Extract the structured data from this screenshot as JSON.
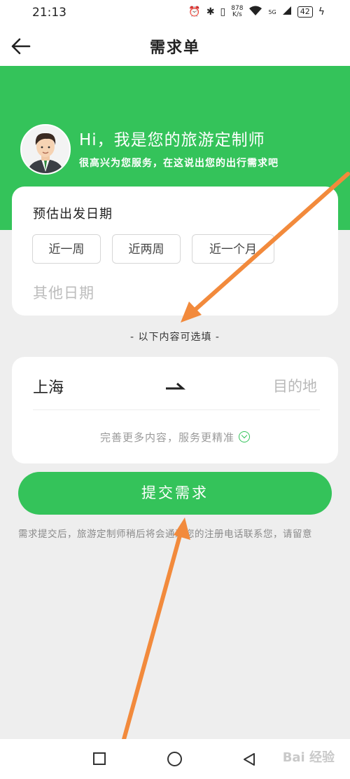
{
  "status_bar": {
    "time": "21:13",
    "net_speed_value": "878",
    "net_speed_unit": "K/s",
    "battery": "42",
    "signal_label": "5G"
  },
  "nav": {
    "title": "需求单",
    "back_icon": "back-arrow-icon"
  },
  "hero": {
    "greeting": "Hi，我是您的旅游定制师",
    "subtitle": "很高兴为您服务，在这说出您的出行需求吧",
    "avatar_icon": "travel-advisor-avatar"
  },
  "date_card": {
    "title": "预估出发日期",
    "options": [
      "近一周",
      "近两周",
      "近一个月"
    ],
    "other_date_placeholder": "其他日期"
  },
  "optional_note": "- 以下内容可选填 -",
  "route_card": {
    "from": "上海",
    "to_placeholder": "目的地",
    "more_info": "完善更多内容，服务更精准"
  },
  "submit_label": "提交需求",
  "footnote": "需求提交后，旅游定制师稍后将会通过您的注册电话联系您，请留意",
  "watermark": "Bai 经验",
  "colors": {
    "accent": "#34c35a",
    "background": "#eeeeee",
    "annotation_arrow": "#f28a3c"
  }
}
